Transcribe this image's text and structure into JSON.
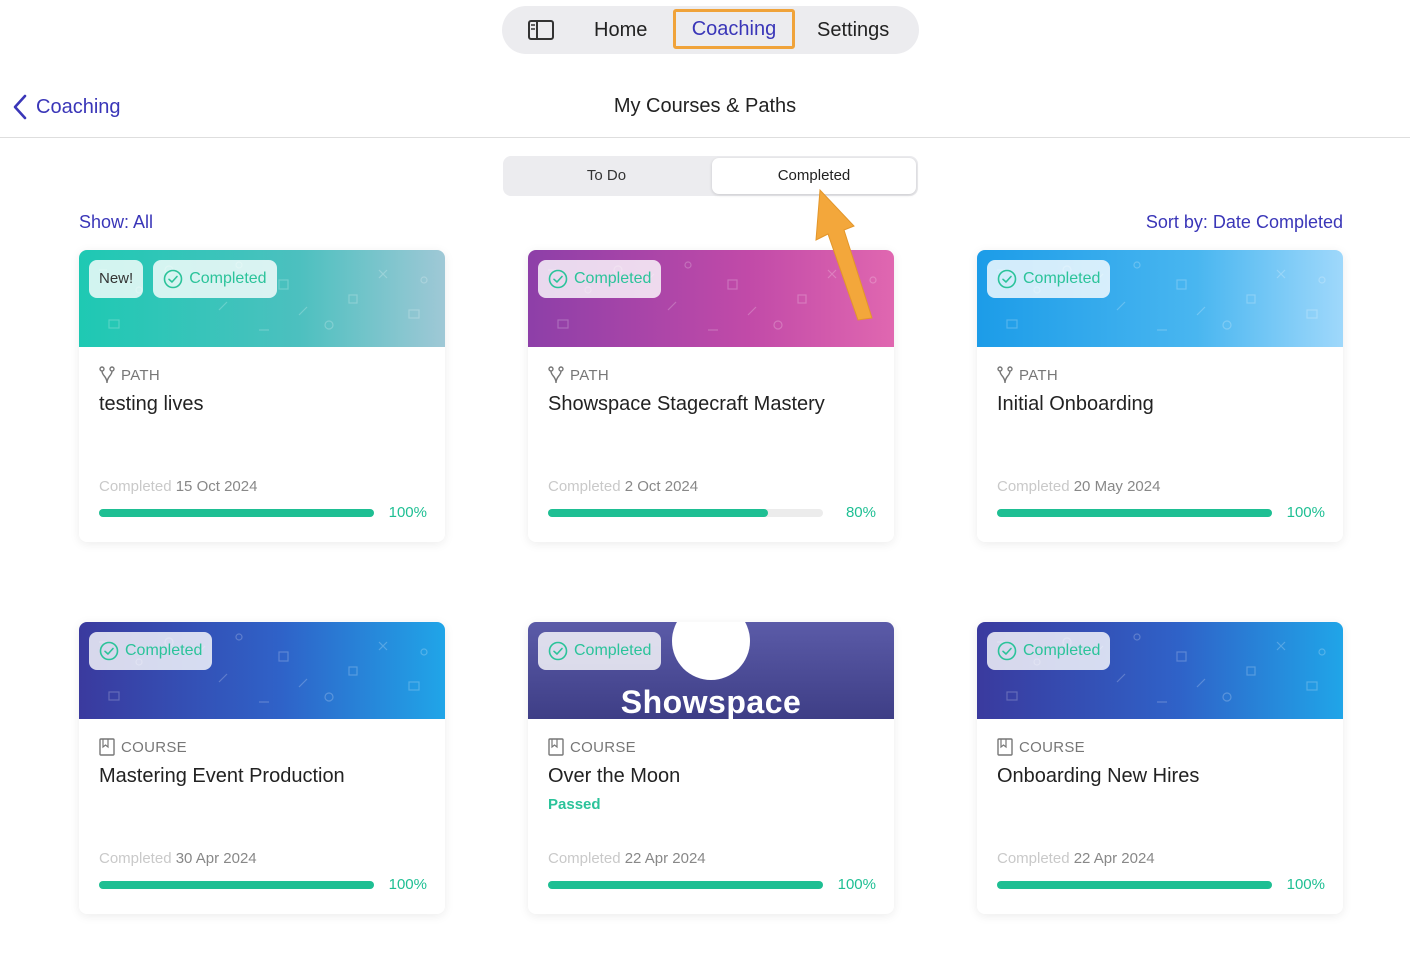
{
  "topnav": {
    "home": "Home",
    "coaching": "Coaching",
    "settings": "Settings"
  },
  "header": {
    "back_label": "Coaching",
    "title": "My Courses & Paths"
  },
  "segment": {
    "todo": "To Do",
    "completed": "Completed"
  },
  "filters": {
    "show": "Show: All",
    "sort": "Sort by: Date Completed"
  },
  "cards": [
    {
      "new_badge": "New!",
      "status": "Completed",
      "type": "PATH",
      "title": "testing lives",
      "completed_label": "Completed",
      "completed_date": "15 Oct 2024",
      "progress": "100%",
      "progress_value": 100
    },
    {
      "status": "Completed",
      "type": "PATH",
      "title": "Showspace Stagecraft Mastery",
      "completed_label": "Completed",
      "completed_date": "2 Oct 2024",
      "progress": "80%",
      "progress_value": 80
    },
    {
      "status": "Completed",
      "type": "PATH",
      "title": "Initial Onboarding",
      "completed_label": "Completed",
      "completed_date": "20 May 2024",
      "progress": "100%",
      "progress_value": 100
    },
    {
      "status": "Completed",
      "type": "COURSE",
      "title": "Mastering Event Production",
      "completed_label": "Completed",
      "completed_date": "30 Apr 2024",
      "progress": "100%",
      "progress_value": 100
    },
    {
      "status": "Completed",
      "type": "COURSE",
      "title": "Over the Moon",
      "banner_text": "Showspace",
      "result": "Passed",
      "completed_label": "Completed",
      "completed_date": "22 Apr 2024",
      "progress": "100%",
      "progress_value": 100
    },
    {
      "status": "Completed",
      "type": "COURSE",
      "title": "Onboarding New Hires",
      "completed_label": "Completed",
      "completed_date": "22 Apr 2024",
      "progress": "100%",
      "progress_value": 100
    }
  ],
  "colors": {
    "accent": "#3a36b8",
    "success": "#1ebf93",
    "highlight": "#f0a33a"
  }
}
